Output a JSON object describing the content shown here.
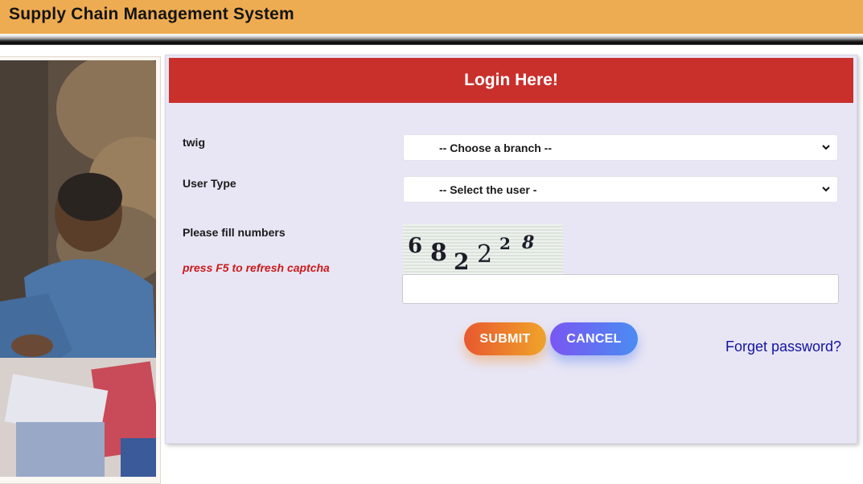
{
  "header": {
    "title": "Supply Chain Management System"
  },
  "login": {
    "title": "Login Here!",
    "branch_label": "twig",
    "branch_selected": "-- Choose a branch --",
    "user_type_label": "User Type",
    "user_type_selected": "-- Select the user -",
    "captcha_label": "Please fill numbers",
    "captcha_hint": "press F5 to refresh captcha",
    "captcha_chars": [
      "6",
      "8",
      "2",
      "2",
      "2",
      "8"
    ],
    "captcha_value": "",
    "submit_label": "SUBMIT",
    "cancel_label": "CANCEL",
    "forget_label": "Forget password?"
  },
  "colors": {
    "header_bg": "#eeac52",
    "login_header_bg": "#c9302c",
    "panel_bg": "#e8e6f5",
    "hint_color": "#cc1a1a",
    "link_color": "#1414a0"
  },
  "icons": [
    "chevron-down-icon",
    "chevron-down-icon"
  ]
}
